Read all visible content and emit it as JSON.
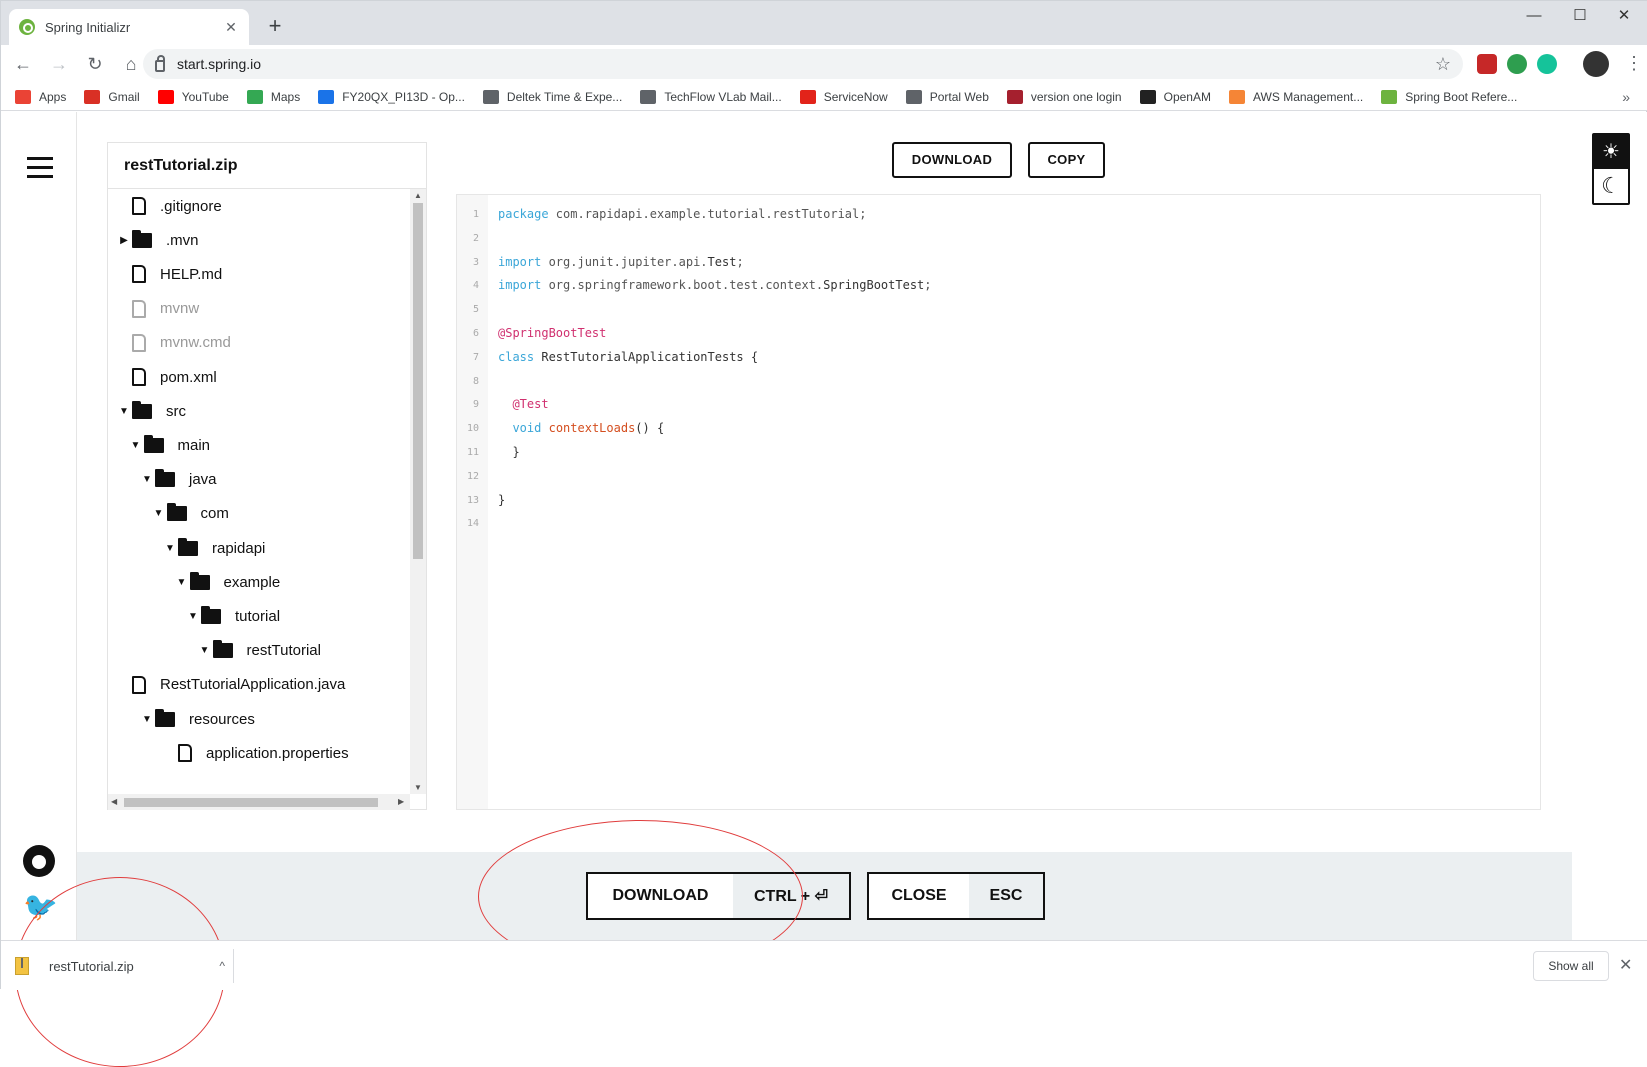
{
  "browser": {
    "tab_title": "Spring Initializr",
    "tab_close": "✕",
    "new_tab": "+",
    "url": "start.spring.io",
    "window_controls": [
      "—",
      "☐",
      "✕"
    ]
  },
  "bookmarks": [
    {
      "label": "Apps",
      "icon": "apps-icon",
      "color": "#ea4335"
    },
    {
      "label": "Gmail",
      "icon": "gmail-icon",
      "color": "#d93025"
    },
    {
      "label": "YouTube",
      "icon": "youtube-icon",
      "color": "#ff0000"
    },
    {
      "label": "Maps",
      "icon": "maps-icon",
      "color": "#34a853"
    },
    {
      "label": "FY20QX_PI13D - Op...",
      "icon": "globe-icon",
      "color": "#1a73e8"
    },
    {
      "label": "Deltek Time & Expe...",
      "icon": "globe-icon",
      "color": "#5f6368"
    },
    {
      "label": "TechFlow VLab Mail...",
      "icon": "globe-icon",
      "color": "#5f6368"
    },
    {
      "label": "ServiceNow",
      "icon": "servicenow-icon",
      "color": "#e2231a"
    },
    {
      "label": "Portal Web",
      "icon": "globe-icon",
      "color": "#5f6368"
    },
    {
      "label": "version one login",
      "icon": "versionone-icon",
      "color": "#a5202e"
    },
    {
      "label": "OpenAM",
      "icon": "openam-icon",
      "color": "#222222"
    },
    {
      "label": "AWS Management...",
      "icon": "aws-icon",
      "color": "#f58536"
    },
    {
      "label": "Spring Boot Refere...",
      "icon": "spring-icon",
      "color": "#6db33f"
    }
  ],
  "bookmarks_more": "»",
  "explorer": {
    "title": "restTutorial.zip",
    "items": [
      {
        "label": ".gitignore",
        "type": "file",
        "depth": 0,
        "arrow": ""
      },
      {
        "label": ".mvn",
        "type": "folder",
        "depth": 0,
        "arrow": "▶"
      },
      {
        "label": "HELP.md",
        "type": "file",
        "depth": 0,
        "arrow": ""
      },
      {
        "label": "mvnw",
        "type": "file-disabled",
        "depth": 0,
        "arrow": ""
      },
      {
        "label": "mvnw.cmd",
        "type": "file-disabled",
        "depth": 0,
        "arrow": ""
      },
      {
        "label": "pom.xml",
        "type": "file",
        "depth": 0,
        "arrow": ""
      },
      {
        "label": "src",
        "type": "folder",
        "depth": 0,
        "arrow": "▼"
      },
      {
        "label": "main",
        "type": "folder",
        "depth": 1,
        "arrow": "▼"
      },
      {
        "label": "java",
        "type": "folder",
        "depth": 2,
        "arrow": "▼"
      },
      {
        "label": "com",
        "type": "folder",
        "depth": 3,
        "arrow": "▼"
      },
      {
        "label": "rapidapi",
        "type": "folder",
        "depth": 4,
        "arrow": "▼"
      },
      {
        "label": "example",
        "type": "folder",
        "depth": 5,
        "arrow": "▼"
      },
      {
        "label": "tutorial",
        "type": "folder",
        "depth": 6,
        "arrow": "▼"
      },
      {
        "label": "restTutorial",
        "type": "folder",
        "depth": 7,
        "arrow": "▼"
      },
      {
        "label": "RestTutorialApplication.java",
        "type": "file",
        "depth": 0,
        "arrow": ""
      },
      {
        "label": "resources",
        "type": "folder",
        "depth": 2,
        "arrow": "▼"
      },
      {
        "label": "application.properties",
        "type": "file",
        "depth": 4,
        "arrow": ""
      }
    ]
  },
  "actions": {
    "download_label": "DOWNLOAD",
    "copy_label": "COPY"
  },
  "code": {
    "line_numbers": [
      "1",
      "2",
      "3",
      "4",
      "5",
      "6",
      "7",
      "8",
      "9",
      "10",
      "11",
      "12",
      "13",
      "14"
    ],
    "lines": [
      [
        {
          "t": "package",
          "c": "kw"
        },
        {
          "t": " com.rapidapi.example.tutorial.restTutorial;",
          "c": ""
        }
      ],
      [],
      [
        {
          "t": "import",
          "c": "kw"
        },
        {
          "t": " org.junit.jupiter.api.",
          "c": ""
        },
        {
          "t": "Test",
          "c": "nm"
        },
        {
          "t": ";",
          "c": ""
        }
      ],
      [
        {
          "t": "import",
          "c": "kw"
        },
        {
          "t": " org.springframework.boot.test.context.",
          "c": ""
        },
        {
          "t": "SpringBootTest",
          "c": "nm"
        },
        {
          "t": ";",
          "c": ""
        }
      ],
      [],
      [
        {
          "t": "@SpringBootTest",
          "c": "an"
        }
      ],
      [
        {
          "t": "class",
          "c": "kw"
        },
        {
          "t": " RestTutorialApplicationTests {",
          "c": "nm"
        }
      ],
      [],
      [
        {
          "t": "  @Test",
          "c": "an"
        }
      ],
      [
        {
          "t": "  void",
          "c": "kw"
        },
        {
          "t": " ",
          "c": ""
        },
        {
          "t": "contextLoads",
          "c": "fn"
        },
        {
          "t": "() {",
          "c": "nm"
        }
      ],
      [
        {
          "t": "  }",
          "c": "nm"
        }
      ],
      [],
      [
        {
          "t": "}",
          "c": "nm"
        }
      ],
      []
    ]
  },
  "theme": {
    "light_icon": "☀",
    "dark_icon": "☾"
  },
  "footer": {
    "download_label": "DOWNLOAD",
    "download_key": "CTRL + ⏎",
    "close_label": "CLOSE",
    "close_key": "ESC"
  },
  "download_bar": {
    "file_name": "restTutorial.zip",
    "caret": "^",
    "show_all": "Show all",
    "close": "✕"
  },
  "colors": {
    "accent_green": "#6db33f",
    "annotation_red": "#e03c3c",
    "footer_bg": "#ebeff1"
  }
}
